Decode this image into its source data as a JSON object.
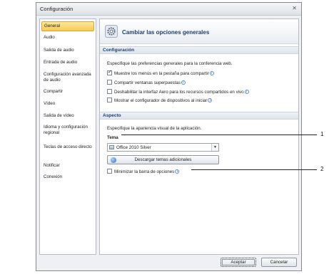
{
  "window": {
    "title": "Configuración",
    "close_glyph": "✕"
  },
  "sidebar": {
    "items": [
      {
        "label": "General",
        "selected": true
      },
      {
        "label": "Audio"
      },
      {
        "label": "Salida de audio"
      },
      {
        "label": "Entrada de audio"
      },
      {
        "label": "Configuración avanzada de audio"
      },
      {
        "label": "Compartir"
      },
      {
        "label": "Vídeo"
      },
      {
        "label": "Salida de vídeo"
      },
      {
        "label": "Idioma y configuración regional"
      },
      {
        "label": "Teclas de acceso directo"
      },
      {
        "label": "Notificar"
      },
      {
        "label": "Conexión"
      }
    ]
  },
  "header": {
    "title": "Cambiar las opciones generales",
    "icon": "gear-icon"
  },
  "config_section": {
    "title": "Configuración",
    "description": "Especifique las preferencias generales para la conferencia web.",
    "options": [
      {
        "label": "Muestre los menús en la pestaña para compartir",
        "checked": true,
        "info": true
      },
      {
        "label": "Compartir ventanas superpuestas",
        "checked": false,
        "info": true
      },
      {
        "label": "Deshabilitar la interfaz Aero para los recursos compartidos en vivo",
        "checked": false,
        "info": true
      },
      {
        "label": "Mostrar el configurador de dispositivos al iniciar",
        "checked": false,
        "info": true
      }
    ]
  },
  "aspect_section": {
    "title": "Aspecto",
    "description": "Especifique la apariencia visual de la aplicación.",
    "theme_label": "Tema",
    "theme_value": "Office 2010 Silver",
    "download_button": "Descargar temas adicionales",
    "minimize_label": "Minimizar la barra de opciones",
    "minimize_checked": false
  },
  "footer": {
    "accept": "Aceptar",
    "cancel": "Cancelar"
  },
  "callouts": [
    "1",
    "2"
  ],
  "info_glyph": "i",
  "check_glyph": "✓",
  "dropdown_arrow": "▼"
}
